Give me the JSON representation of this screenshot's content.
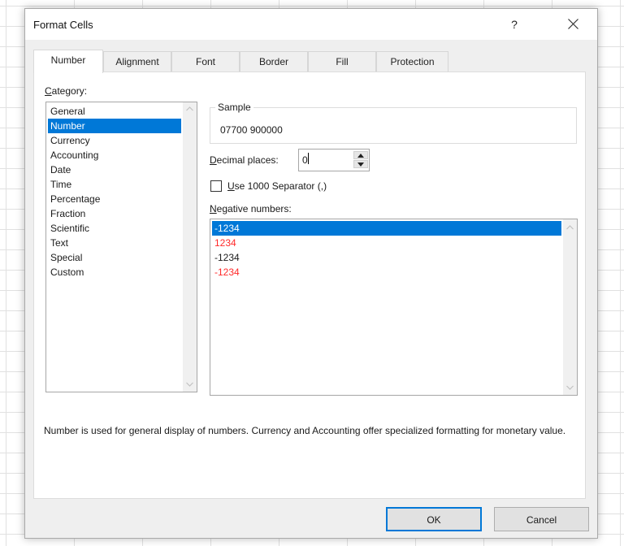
{
  "window": {
    "title": "Format Cells",
    "help_label": "?",
    "close_icon": "close-icon"
  },
  "tabs": [
    {
      "label": "Number",
      "active": true
    },
    {
      "label": "Alignment",
      "active": false
    },
    {
      "label": "Font",
      "active": false
    },
    {
      "label": "Border",
      "active": false
    },
    {
      "label": "Fill",
      "active": false
    },
    {
      "label": "Protection",
      "active": false
    }
  ],
  "category": {
    "label_accel": "C",
    "label_rest": "ategory:",
    "items": [
      {
        "label": "General"
      },
      {
        "label": "Number",
        "selected": true
      },
      {
        "label": "Currency"
      },
      {
        "label": "Accounting"
      },
      {
        "label": "Date"
      },
      {
        "label": "Time"
      },
      {
        "label": "Percentage"
      },
      {
        "label": "Fraction"
      },
      {
        "label": "Scientific"
      },
      {
        "label": "Text"
      },
      {
        "label": "Special"
      },
      {
        "label": "Custom"
      }
    ]
  },
  "sample": {
    "label": "Sample",
    "value": "07700 900000"
  },
  "decimal_places": {
    "label_accel": "D",
    "label_rest": "ecimal places:",
    "value": "0"
  },
  "separator": {
    "label_accel": "U",
    "label_rest": "se 1000 Separator (,)",
    "checked": false
  },
  "negative_numbers": {
    "label_accel": "N",
    "label_rest": "egative numbers:",
    "items": [
      {
        "label": "-1234",
        "color": "#ffffff",
        "selected": true
      },
      {
        "label": "1234",
        "color": "#ff2a2a"
      },
      {
        "label": "-1234",
        "color": "#1a1a1a"
      },
      {
        "label": "-1234",
        "color": "#ff2a2a"
      }
    ]
  },
  "description": "Number is used for general display of numbers.  Currency and Accounting offer specialized formatting for monetary value.",
  "buttons": {
    "ok": "OK",
    "cancel": "Cancel"
  },
  "colors": {
    "selection": "#0078d7",
    "negative_red": "#ff2a2a"
  }
}
